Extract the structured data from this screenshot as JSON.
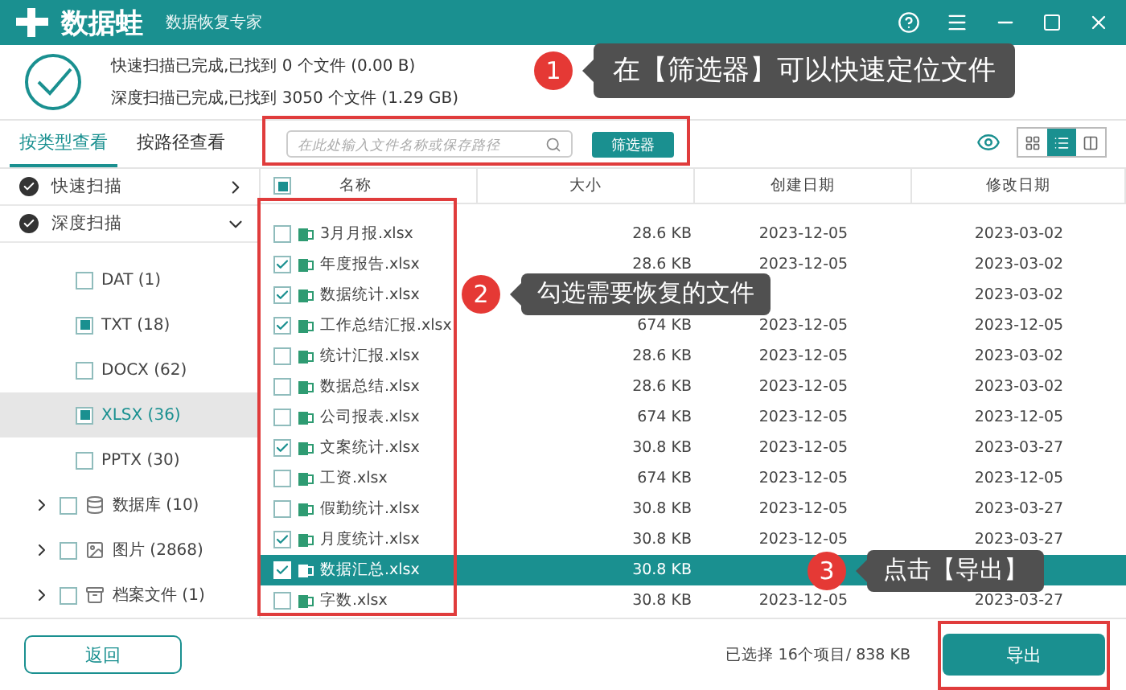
{
  "app": {
    "name": "数据蛙",
    "subtitle": "数据恢复专家"
  },
  "scan_summary": {
    "done": true,
    "lines": [
      "快速扫描已完成,已找到 0 个文件 (0.00  B)",
      "深度扫描已完成,已找到 3050 个文件 (1.29 GB)"
    ]
  },
  "tabs": [
    {
      "label": "按类型查看",
      "selected": true
    },
    {
      "label": "按路径查看",
      "selected": false
    }
  ],
  "search": {
    "placeholder": "在此处输入文件名称或保存路径"
  },
  "filter_button": "筛选器",
  "view_modes": [
    {
      "kind": "grid",
      "selected": false
    },
    {
      "kind": "list",
      "selected": true
    },
    {
      "kind": "columns",
      "selected": false
    }
  ],
  "sidebar": {
    "scans": [
      {
        "label": "快速扫描",
        "expanded": false
      },
      {
        "label": "深度扫描",
        "expanded": true,
        "children": [
          {
            "kind": "type",
            "label": "DAT (1)",
            "partial": false,
            "selected": false
          },
          {
            "kind": "type",
            "label": "TXT (18)",
            "partial": true,
            "selected": false
          },
          {
            "kind": "type",
            "label": "DOCX (62)",
            "partial": false,
            "selected": false
          },
          {
            "kind": "type",
            "label": "XLSX (36)",
            "partial": true,
            "selected": true
          },
          {
            "kind": "type",
            "label": "PPTX (30)",
            "partial": false,
            "selected": false
          },
          {
            "kind": "database",
            "label": "数据库 (10)",
            "partial": false,
            "selected": false,
            "expanded": false
          },
          {
            "kind": "image",
            "label": "图片 (2868)",
            "partial": false,
            "selected": false,
            "expanded": false
          },
          {
            "kind": "archive",
            "label": "档案文件 (1)",
            "partial": false,
            "selected": false,
            "expanded": false
          }
        ]
      }
    ]
  },
  "table": {
    "all_partial": true,
    "columns": [
      "名称",
      "大小",
      "创建日期",
      "修改日期"
    ],
    "rows": [
      {
        "name": "3月月报.xlsx",
        "size": "28.6 KB",
        "created": "2023-12-05",
        "modified": "2023-03-02",
        "checked": false,
        "selected": false
      },
      {
        "name": "年度报告.xlsx",
        "size": "28.6 KB",
        "created": "2023-12-05",
        "modified": "2023-03-02",
        "checked": true,
        "selected": false
      },
      {
        "name": "数据统计.xlsx",
        "modified": "2023-03-02",
        "checked": true,
        "selected": false
      },
      {
        "name": "工作总结汇报.xlsx",
        "size": "674 KB",
        "created": "2023-12-05",
        "modified": "2023-12-05",
        "checked": true,
        "selected": false
      },
      {
        "name": "统计汇报.xlsx",
        "size": "28.6 KB",
        "created": "2023-12-05",
        "modified": "2023-03-02",
        "checked": false,
        "selected": false
      },
      {
        "name": "数据总结.xlsx",
        "size": "28.6 KB",
        "created": "2023-12-05",
        "modified": "2023-03-02",
        "checked": false,
        "selected": false
      },
      {
        "name": "公司报表.xlsx",
        "size": "674 KB",
        "created": "2023-12-05",
        "modified": "2023-12-05",
        "checked": false,
        "selected": false
      },
      {
        "name": "文案统计.xlsx",
        "size": "30.8 KB",
        "created": "2023-12-05",
        "modified": "2023-03-27",
        "checked": true,
        "selected": false
      },
      {
        "name": "工资.xlsx",
        "size": "674 KB",
        "created": "2023-12-05",
        "modified": "2023-12-05",
        "checked": false,
        "selected": false
      },
      {
        "name": "假勤统计.xlsx",
        "size": "30.8 KB",
        "created": "2023-12-05",
        "modified": "2023-03-27",
        "checked": false,
        "selected": false
      },
      {
        "name": "月度统计.xlsx",
        "size": "30.8 KB",
        "created": "2023-12-05",
        "modified": "2023-03-27",
        "checked": true,
        "selected": false
      },
      {
        "name": "数据汇总.xlsx",
        "size": "30.8 KB",
        "checked": true,
        "selected": true
      },
      {
        "name": "字数.xlsx",
        "size": "30.8 KB",
        "created": "2023-12-05",
        "modified": "2023-03-27",
        "checked": false,
        "selected": false
      }
    ]
  },
  "footer": {
    "back_button": "返回",
    "selection": "已选择 16个项目/ 838 KB",
    "export_button": "导出"
  },
  "annotations": [
    {
      "number": "1",
      "text": "在【筛选器】可以快速定位文件"
    },
    {
      "number": "2",
      "text": "勾选需要恢复的文件"
    },
    {
      "number": "3",
      "text": "点击【导出】"
    }
  ]
}
